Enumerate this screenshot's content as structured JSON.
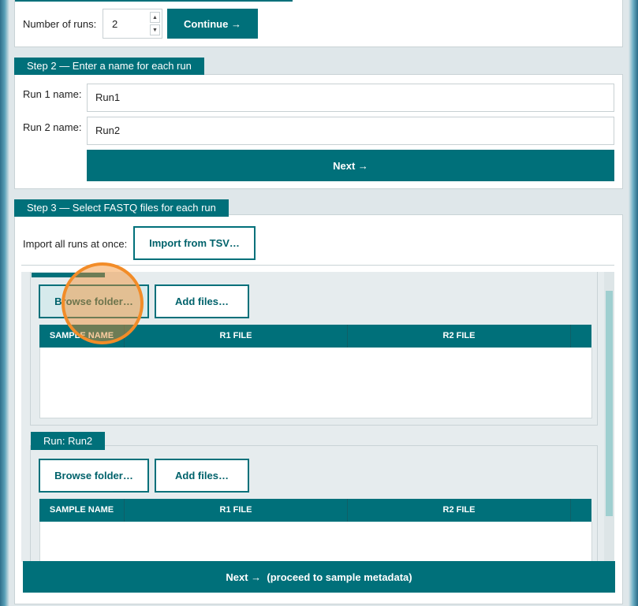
{
  "step1": {
    "runs_label": "Number of runs:",
    "runs_value": "2",
    "continue_label": "Continue →"
  },
  "step2": {
    "legend": "Step 2 — Enter a name for each run",
    "run1_label": "Run 1 name:",
    "run1_value": "Run1",
    "run2_label": "Run 2 name:",
    "run2_value": "Run2",
    "next_label": "Next →"
  },
  "step3": {
    "legend": "Step 3 — Select FASTQ files for each run",
    "import_label": "Import all runs at once:",
    "import_button": "Import from TSV…",
    "runs": [
      {
        "title": "",
        "browse_label": "Browse folder…",
        "add_label": "Add files…",
        "columns": [
          "SAMPLE NAME",
          "R1 FILE",
          "R2 FILE"
        ]
      },
      {
        "title": "Run: Run2",
        "browse_label": "Browse folder…",
        "add_label": "Add files…",
        "columns": [
          "SAMPLE NAME",
          "R1 FILE",
          "R2 FILE"
        ]
      }
    ],
    "proceed_label": "Next →  (proceed to sample metadata)"
  },
  "colors": {
    "accent": "#00707a",
    "cursor_highlight": "#f28c28"
  }
}
